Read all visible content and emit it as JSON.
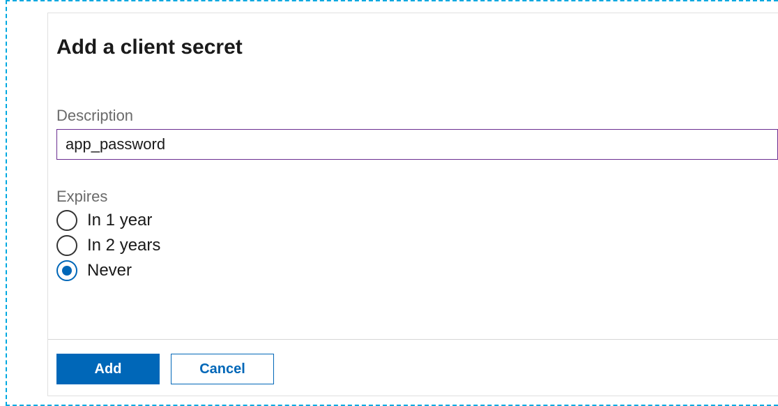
{
  "panel": {
    "title": "Add a client secret",
    "description": {
      "label": "Description",
      "value": "app_password"
    },
    "expires": {
      "label": "Expires",
      "options": [
        {
          "label": "In 1 year",
          "selected": false
        },
        {
          "label": "In 2 years",
          "selected": false
        },
        {
          "label": "Never",
          "selected": true
        }
      ]
    },
    "buttons": {
      "add": "Add",
      "cancel": "Cancel"
    }
  }
}
